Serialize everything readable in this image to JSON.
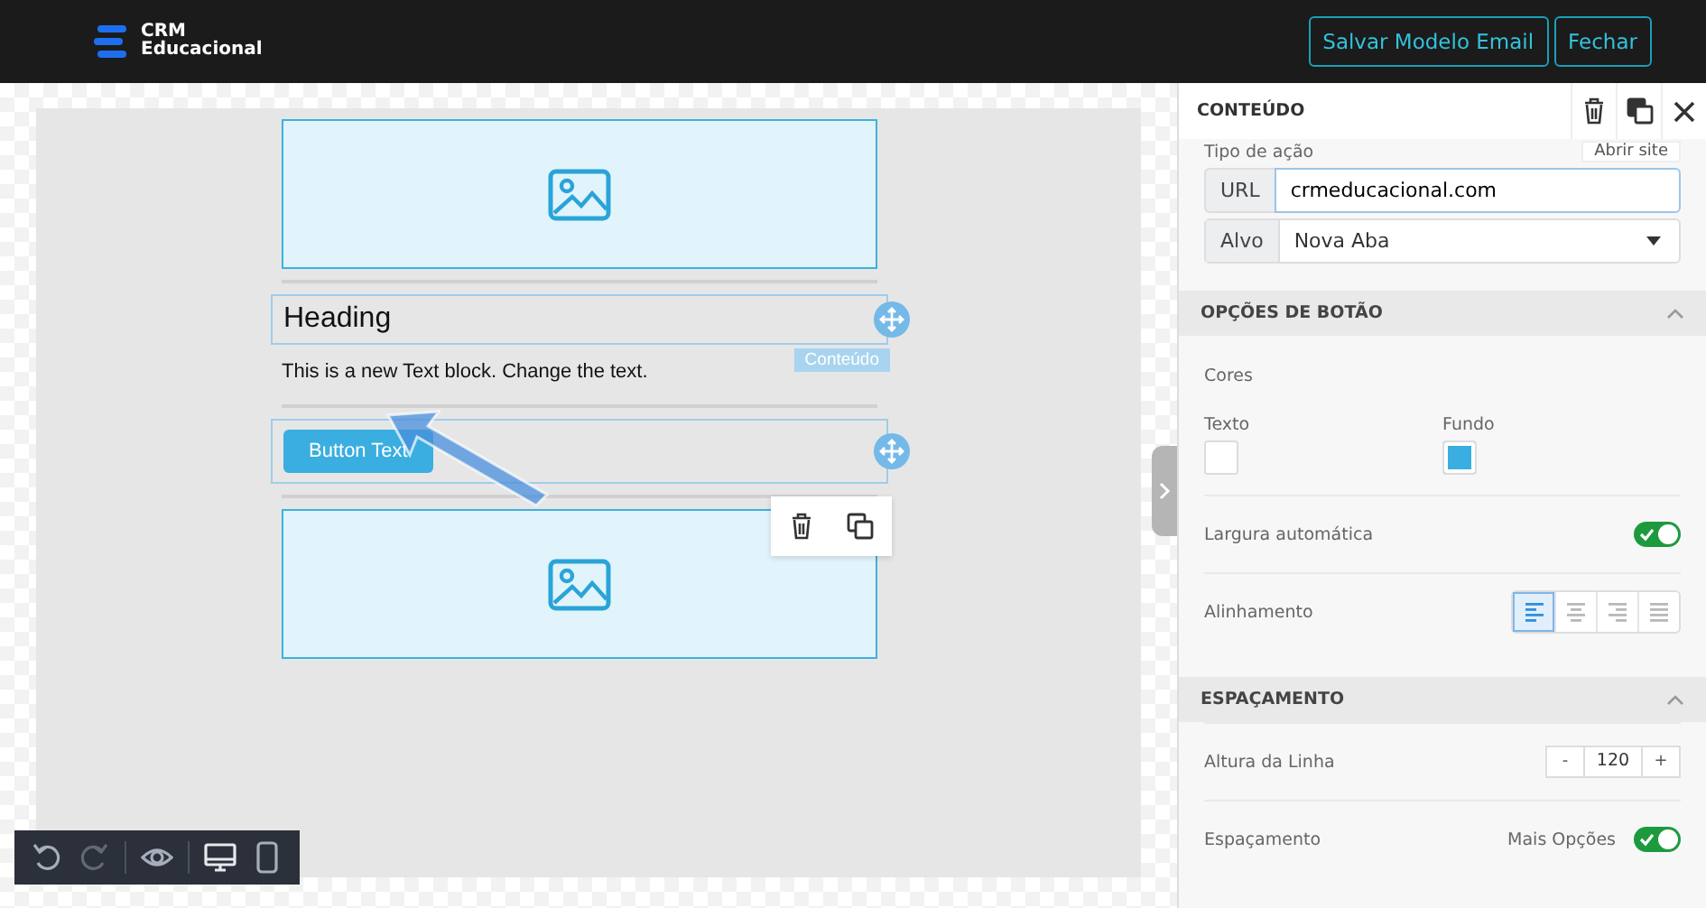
{
  "header": {
    "logo": [
      "CRM",
      "Educacional"
    ],
    "buttons": [
      "Salvar Modelo Email",
      "Fechar"
    ]
  },
  "canvas": {
    "blocks": [
      {
        "kind": "image"
      },
      {
        "kind": "divider"
      },
      {
        "kind": "heading",
        "text": "Heading",
        "outlined": true,
        "badge": "Conteúdo"
      },
      {
        "kind": "text",
        "text": "This is a new Text block. Change the text."
      },
      {
        "kind": "divider"
      },
      {
        "kind": "button",
        "text": "Button Text",
        "outlined": true
      },
      {
        "kind": "divider"
      },
      {
        "kind": "image"
      }
    ]
  },
  "toolbar": {
    "items": [
      {
        "kind": "undo",
        "disabled": false,
        "selected": false
      },
      {
        "kind": "redo",
        "disabled": true,
        "selected": false
      },
      {
        "kind": "preview",
        "disabled": false,
        "selected": false
      },
      {
        "kind": "desktop",
        "disabled": false,
        "selected": true
      },
      {
        "kind": "mobile",
        "disabled": false,
        "selected": false
      }
    ]
  },
  "panel": {
    "title": "CONTEÚDO",
    "action": {
      "label": "Tipo de ação",
      "value": "Abrir site"
    },
    "url": {
      "label": "URL",
      "value": "crmeducacional.com"
    },
    "target": {
      "label": "Alvo",
      "value": "Nova Aba"
    },
    "sections": [
      {
        "title": "OPÇÕES DE BOTÃO",
        "expanded": true,
        "rows": [
          {
            "kind": "heading",
            "label": "Cores"
          },
          {
            "kind": "colors",
            "items": [
              {
                "label": "Texto",
                "color": "#ffffff"
              },
              {
                "label": "Fundo",
                "color": "#3aaee0"
              }
            ]
          },
          {
            "kind": "toggle",
            "label": "Largura automática",
            "on": true
          },
          {
            "kind": "align",
            "label": "Alinhamento",
            "options": [
              {
                "kind": "left",
                "selected": true
              },
              {
                "kind": "center",
                "selected": false
              },
              {
                "kind": "right",
                "selected": false
              },
              {
                "kind": "justify",
                "selected": false
              }
            ]
          }
        ]
      },
      {
        "title": "ESPAÇAMENTO",
        "expanded": true,
        "rows": [
          {
            "kind": "stepper",
            "label": "Altura da Linha",
            "minus": "-",
            "value": "120",
            "plus": "+"
          },
          {
            "kind": "toggle",
            "label": "Espaçamento",
            "extra": "Mais Opções",
            "on": true
          }
        ]
      }
    ]
  }
}
